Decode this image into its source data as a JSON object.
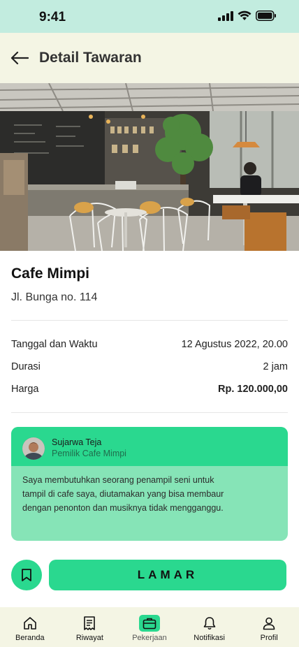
{
  "status_bar": {
    "time": "9:41"
  },
  "header": {
    "title": "Detail Tawaran"
  },
  "venue": {
    "name": "Cafe Mimpi",
    "address": "Jl. Bunga no. 114"
  },
  "details": [
    {
      "label": "Tanggal dan Waktu",
      "value": "12 Agustus 2022, 20.00"
    },
    {
      "label": "Durasi",
      "value": "2 jam"
    },
    {
      "label": "Harga",
      "value": "Rp. 120.000,00"
    }
  ],
  "owner": {
    "name": "Sujarwa Teja",
    "role": "Pemilik Cafe Mimpi",
    "message": "Saya membutuhkan seorang penampil seni untuk tampil di cafe saya, diutamakan yang bisa membaur dengan penonton dan musiknya tidak mengganggu."
  },
  "actions": {
    "apply_label": "LAMAR"
  },
  "nav": [
    {
      "label": "Beranda",
      "icon": "home-icon",
      "active": false
    },
    {
      "label": "Riwayat",
      "icon": "receipt-icon",
      "active": false
    },
    {
      "label": "Pekerjaan",
      "icon": "briefcase-icon",
      "active": true
    },
    {
      "label": "Notifikasi",
      "icon": "bell-icon",
      "active": false
    },
    {
      "label": "Profil",
      "icon": "user-icon",
      "active": false
    }
  ],
  "colors": {
    "accent": "#2ad88f",
    "card_body": "#86e4b7",
    "header_bg": "#f4f5e4",
    "status_bg": "#c2ecdf"
  }
}
